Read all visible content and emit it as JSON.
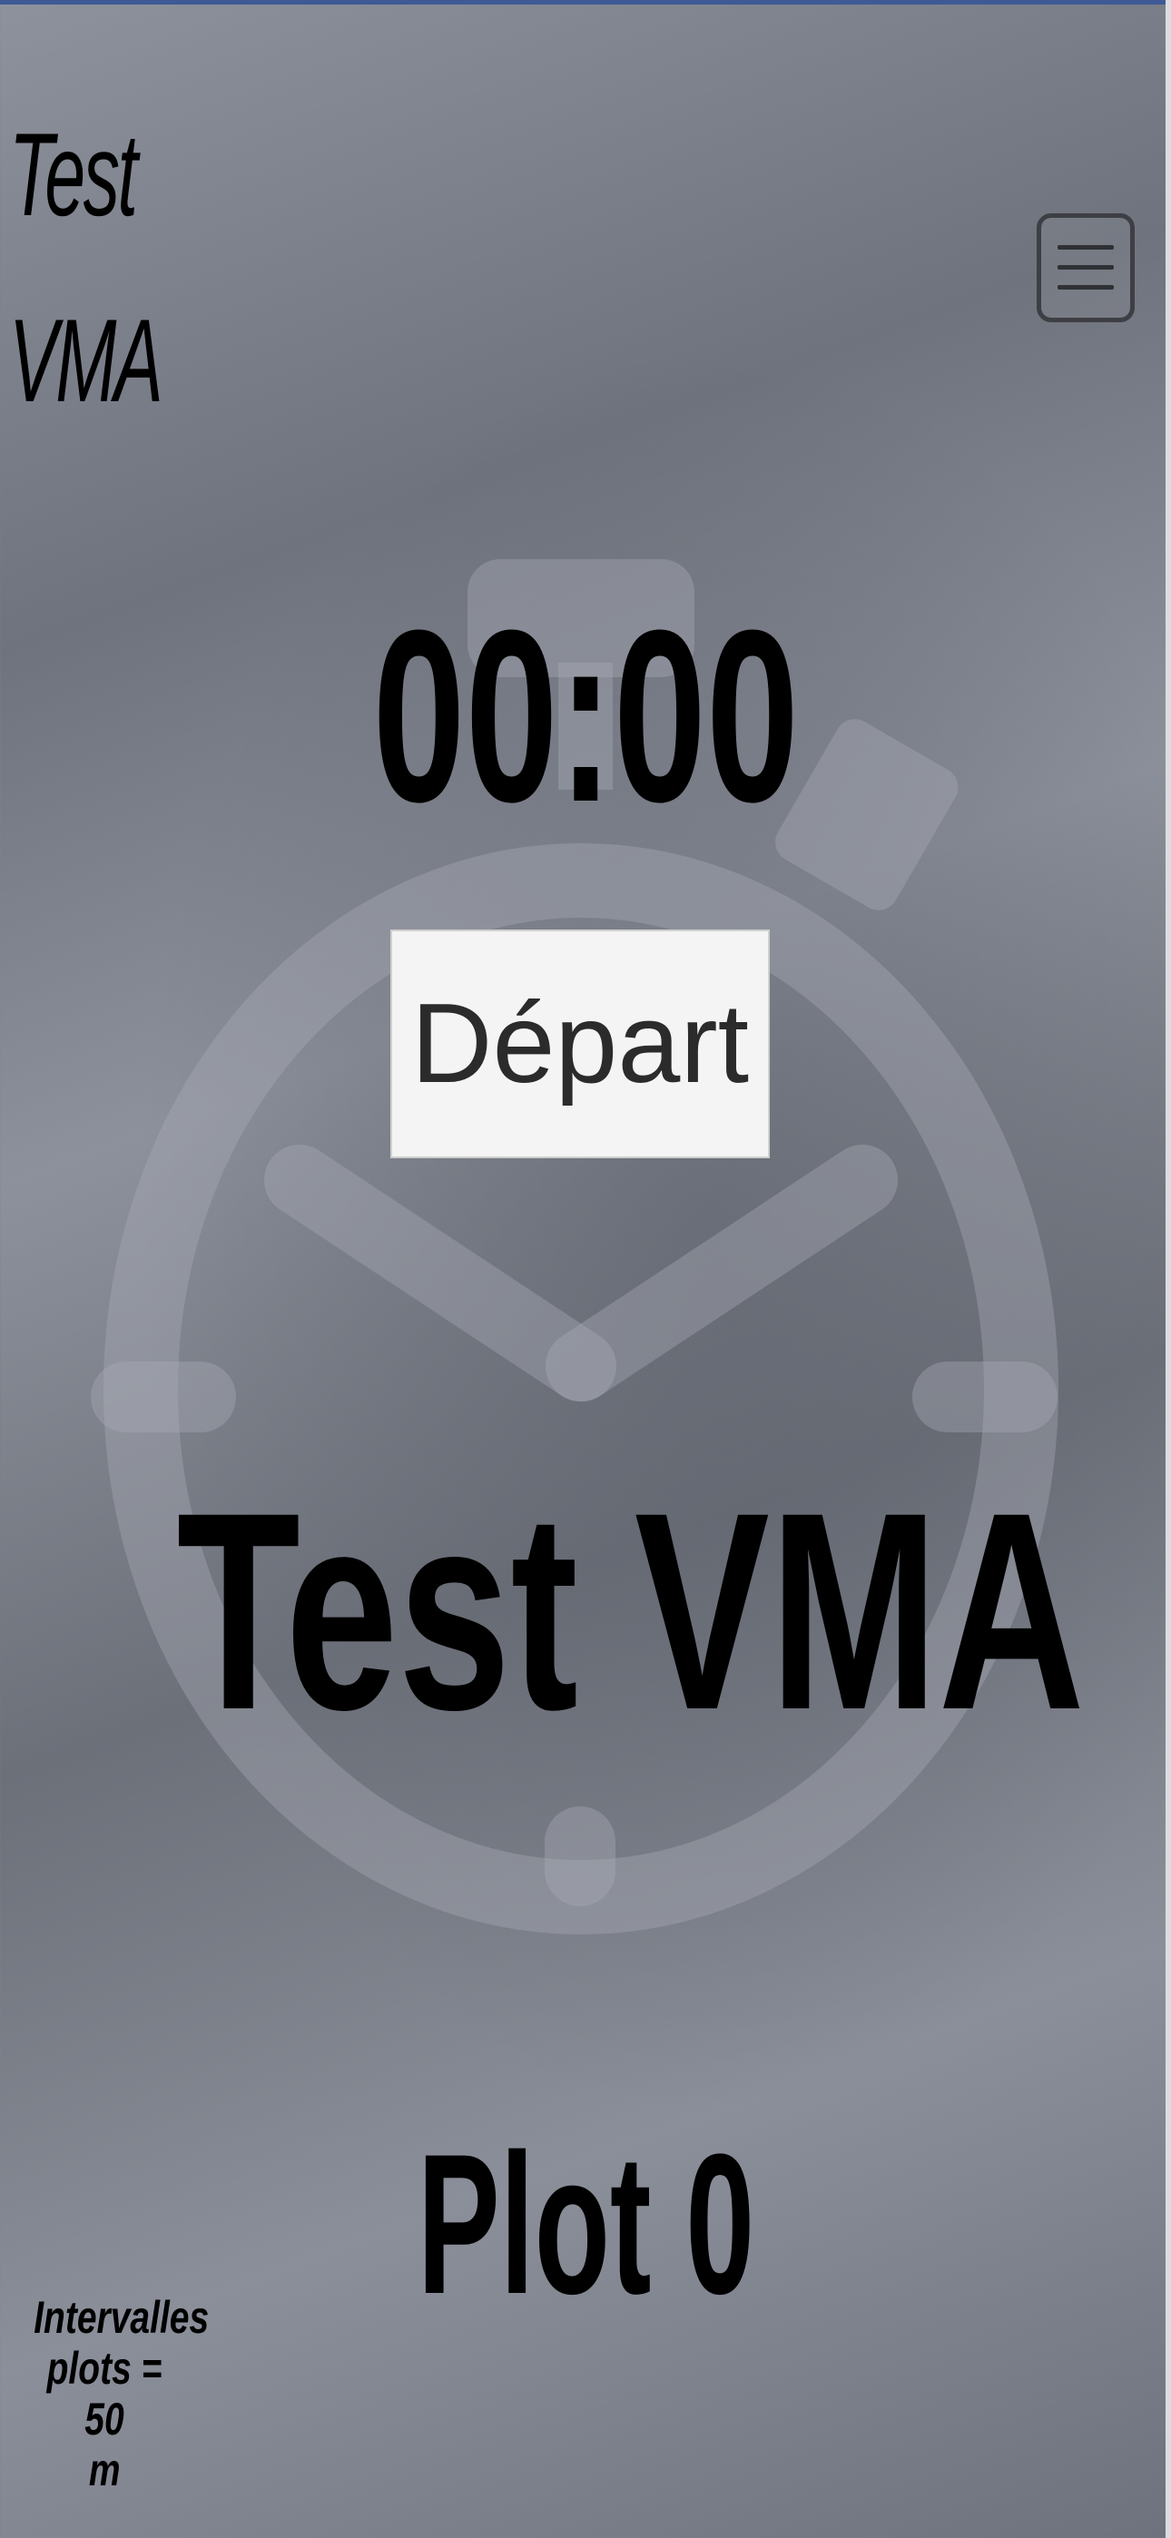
{
  "app": {
    "logo_line1": "Test",
    "logo_line2": "VMA"
  },
  "menu": {
    "icon": "hamburger-menu-icon"
  },
  "background": {
    "icon": "stopwatch-icon"
  },
  "timer": {
    "value": "00:00"
  },
  "controls": {
    "start_label": "Départ"
  },
  "main": {
    "title": "Test VMA",
    "plot_label": "Plot 0"
  },
  "footer": {
    "interval_line1": "Intervalles",
    "interval_line2": "plots = 50",
    "interval_line3": "m"
  },
  "colors": {
    "background": "#7d818b",
    "text": "#000000",
    "button_bg": "#f4f4f4",
    "button_text": "#2b2b2b"
  }
}
